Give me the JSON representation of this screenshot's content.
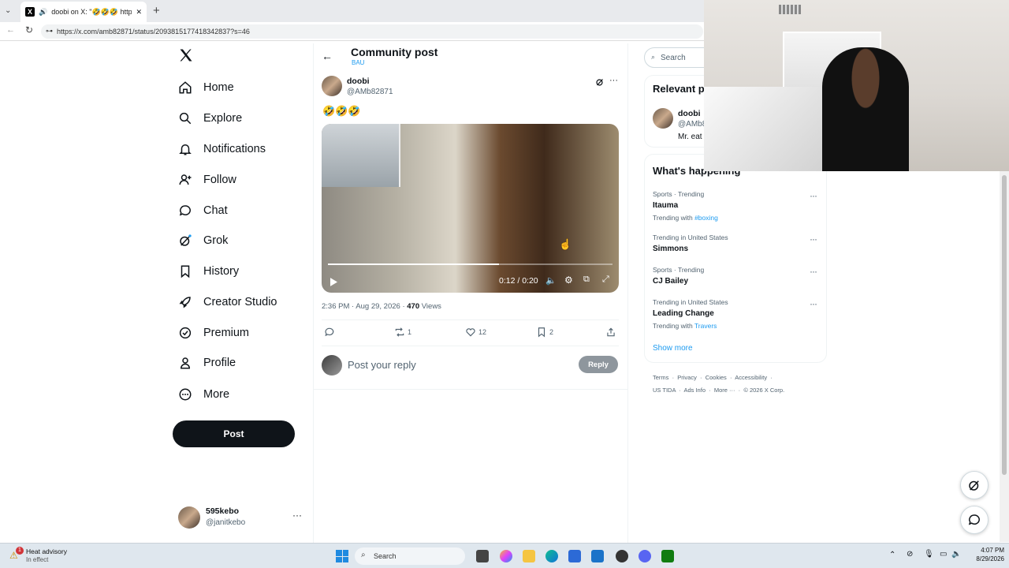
{
  "browser": {
    "tab_title": "doobi on X: \"🤣🤣🤣 https://",
    "url": "https://x.com/amb82871/status/2093815177418342837?s=46",
    "tab_close": "✕",
    "new_tab": "+"
  },
  "nav": {
    "items": [
      {
        "label": "Home",
        "icon": "home-icon"
      },
      {
        "label": "Explore",
        "icon": "search-icon"
      },
      {
        "label": "Notifications",
        "icon": "bell-icon"
      },
      {
        "label": "Follow",
        "icon": "person-plus-icon"
      },
      {
        "label": "Chat",
        "icon": "chat-bubble-icon"
      },
      {
        "label": "Grok",
        "icon": "grok-icon"
      },
      {
        "label": "History",
        "icon": "bookmark-icon"
      },
      {
        "label": "Creator Studio",
        "icon": "rocket-icon"
      },
      {
        "label": "Premium",
        "icon": "verified-badge-icon"
      },
      {
        "label": "Profile",
        "icon": "person-icon"
      },
      {
        "label": "More",
        "icon": "more-circle-icon"
      }
    ],
    "post_label": "Post",
    "account": {
      "name": "595kebo",
      "handle": "@janitkebo"
    }
  },
  "main": {
    "header_title": "Community post",
    "header_subtitle": "BAU",
    "author_name": "doobi",
    "author_handle": "@AMb82871",
    "tweet_text": "🤣🤣🤣",
    "video": {
      "time": "0:12 / 0:20",
      "progress": 0.6
    },
    "timestamp": "2:36 PM · Aug 29, 2026 · ",
    "views_count": "470",
    "views_label": " Views",
    "actions": {
      "replies": "",
      "reposts": "1",
      "likes": "12",
      "bookmarks": "2"
    },
    "reply_placeholder": "Post your reply",
    "reply_button": "Reply"
  },
  "sidebar": {
    "search_placeholder": "Search",
    "relevant_title": "Relevant p",
    "relevant_name": "doobi",
    "relevant_handle": "@AMb8",
    "relevant_bio": "Mr. eat",
    "happening_title": "What's happening",
    "trends": [
      {
        "meta": "Sports · Trending",
        "name": "Itauma",
        "with_prefix": "Trending with ",
        "with_link": "#boxing"
      },
      {
        "meta": "Trending in United States",
        "name": "Simmons",
        "with_prefix": "",
        "with_link": ""
      },
      {
        "meta": "Sports · Trending",
        "name": "CJ Bailey",
        "with_prefix": "",
        "with_link": ""
      },
      {
        "meta": "Trending in United States",
        "name": "Leading Change",
        "with_prefix": "Trending with ",
        "with_link": "Travers"
      }
    ],
    "show_more": "Show more",
    "footer_line1": [
      "Terms",
      "Privacy",
      "Cookies",
      "Accessibility"
    ],
    "footer_line2": [
      "US TIDA",
      "Ads Info",
      "More ···",
      "© 2026 X Corp."
    ]
  },
  "taskbar": {
    "weather_title": "Heat advisory",
    "weather_sub": "In effect",
    "weather_badge": "1",
    "search_label": "Search",
    "time": "4:07 PM",
    "date": "8/29/2026"
  },
  "colors": {
    "accent": "#1d9bf0",
    "text": "#0f1419",
    "muted": "#536471",
    "post_button": "#0f1419"
  }
}
